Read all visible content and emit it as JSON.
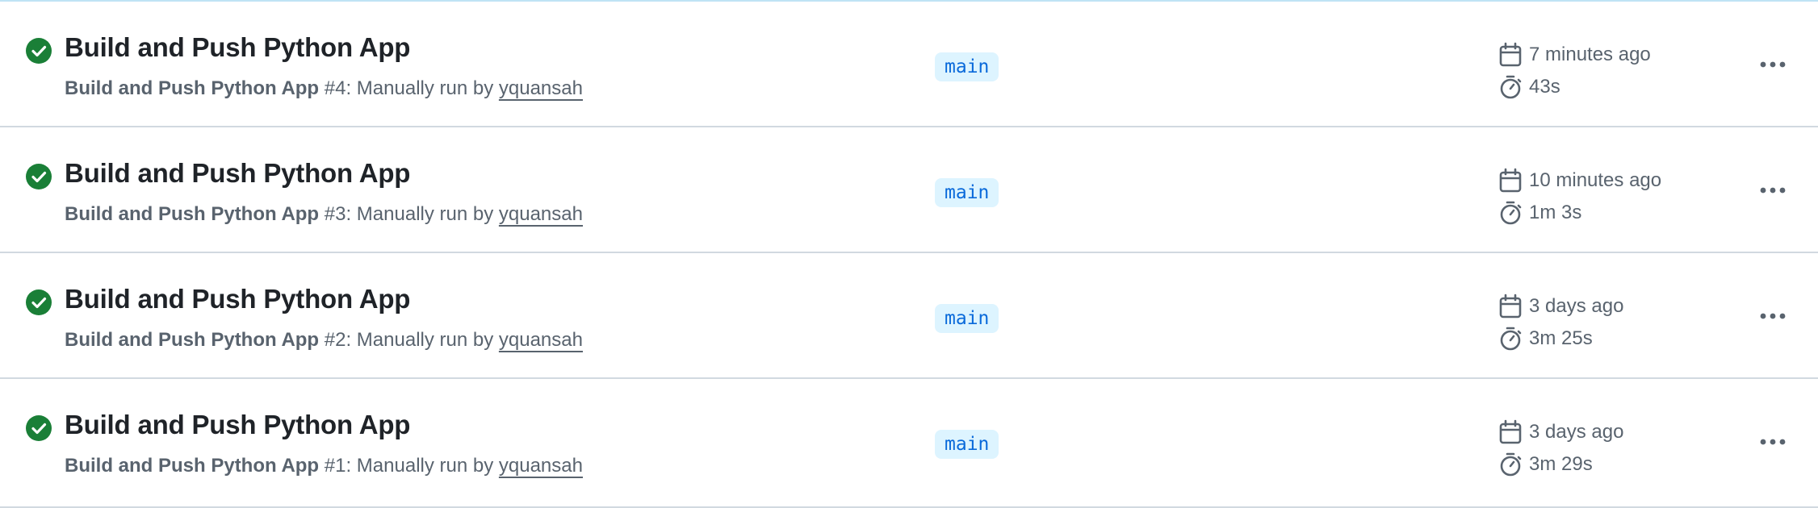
{
  "colors": {
    "success": "#1a7f37",
    "branch_bg": "#ddf4ff",
    "branch_text": "#0969da",
    "muted_text": "#59636e",
    "title_text": "#1f2328"
  },
  "icons": {
    "status": "check-circle-icon",
    "created": "calendar-icon",
    "duration": "stopwatch-icon",
    "menu": "kebab-menu-icon"
  },
  "runs": [
    {
      "title": "Build and Push Python App",
      "workflow_name": "Build and Push Python App",
      "run_number": "#4",
      "trigger_text": ": Manually run by ",
      "actor": "yquansah",
      "branch": "main",
      "created": "7 minutes ago",
      "duration": "43s"
    },
    {
      "title": "Build and Push Python App",
      "workflow_name": "Build and Push Python App",
      "run_number": "#3",
      "trigger_text": ": Manually run by ",
      "actor": "yquansah",
      "branch": "main",
      "created": "10 minutes ago",
      "duration": "1m 3s"
    },
    {
      "title": "Build and Push Python App",
      "workflow_name": "Build and Push Python App",
      "run_number": "#2",
      "trigger_text": ": Manually run by ",
      "actor": "yquansah",
      "branch": "main",
      "created": "3 days ago",
      "duration": "3m 25s"
    },
    {
      "title": "Build and Push Python App",
      "workflow_name": "Build and Push Python App",
      "run_number": "#1",
      "trigger_text": ": Manually run by ",
      "actor": "yquansah",
      "branch": "main",
      "created": "3 days ago",
      "duration": "3m 29s"
    }
  ]
}
